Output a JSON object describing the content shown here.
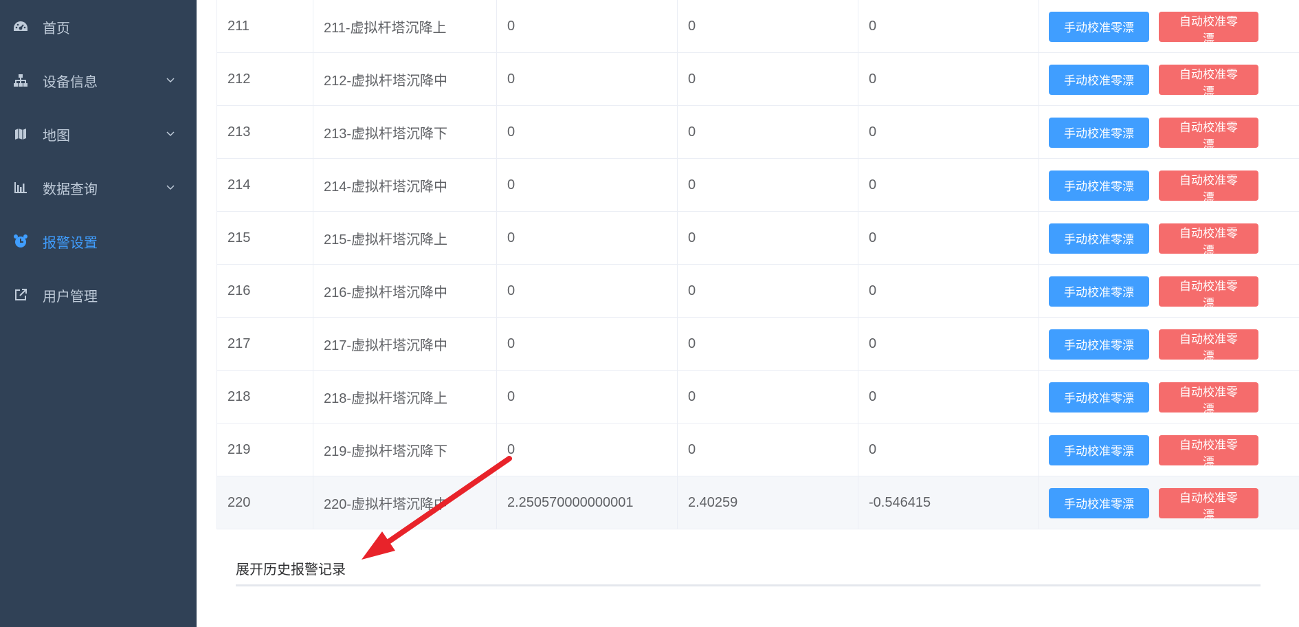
{
  "sidebar": {
    "items": [
      {
        "label": "首页",
        "icon": "dashboard-icon",
        "active": false,
        "expandable": false
      },
      {
        "label": "设备信息",
        "icon": "sitemap-icon",
        "active": false,
        "expandable": true
      },
      {
        "label": "地图",
        "icon": "map-icon",
        "active": false,
        "expandable": true
      },
      {
        "label": "数据查询",
        "icon": "bar-chart-icon",
        "active": false,
        "expandable": true
      },
      {
        "label": "报警设置",
        "icon": "alarm-clock-icon",
        "active": true,
        "expandable": false
      },
      {
        "label": "用户管理",
        "icon": "external-link-icon",
        "active": false,
        "expandable": false
      }
    ],
    "colors": {
      "background": "#304156",
      "text": "#bfcbd9",
      "active": "#409eff"
    }
  },
  "table": {
    "rows": [
      {
        "id": "211",
        "name": "211-虚拟杆塔沉降上",
        "v1": "0",
        "v2": "0",
        "v3": "0"
      },
      {
        "id": "212",
        "name": "212-虚拟杆塔沉降中",
        "v1": "0",
        "v2": "0",
        "v3": "0"
      },
      {
        "id": "213",
        "name": "213-虚拟杆塔沉降下",
        "v1": "0",
        "v2": "0",
        "v3": "0"
      },
      {
        "id": "214",
        "name": "214-虚拟杆塔沉降中",
        "v1": "0",
        "v2": "0",
        "v3": "0"
      },
      {
        "id": "215",
        "name": "215-虚拟杆塔沉降上",
        "v1": "0",
        "v2": "0",
        "v3": "0"
      },
      {
        "id": "216",
        "name": "216-虚拟杆塔沉降中",
        "v1": "0",
        "v2": "0",
        "v3": "0"
      },
      {
        "id": "217",
        "name": "217-虚拟杆塔沉降中",
        "v1": "0",
        "v2": "0",
        "v3": "0"
      },
      {
        "id": "218",
        "name": "218-虚拟杆塔沉降上",
        "v1": "0",
        "v2": "0",
        "v3": "0"
      },
      {
        "id": "219",
        "name": "219-虚拟杆塔沉降下",
        "v1": "0",
        "v2": "0",
        "v3": "0"
      },
      {
        "id": "220",
        "name": "220-虚拟杆塔沉降中",
        "v1": "2.250570000000001",
        "v2": "2.40259",
        "v3": "-0.546415"
      }
    ],
    "manual_button_label": "手动校准零漂",
    "auto_button_label": "自动校准零漂",
    "colors": {
      "primary": "#409eff",
      "danger": "#f56c6c",
      "highlight_row": "#f5f7fa"
    }
  },
  "footer": {
    "expand_label": "展开历史报警记录"
  },
  "annotation": {
    "arrow_color": "#e8232a"
  }
}
